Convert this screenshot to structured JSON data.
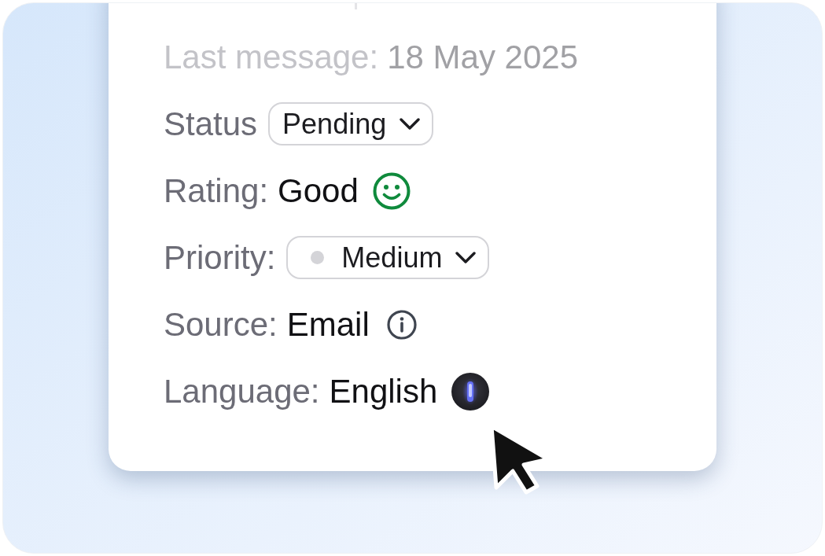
{
  "last_message": {
    "label": "Last message:",
    "value": "18 May 2025"
  },
  "fields": [
    {
      "kind": "dropdown",
      "label": "Status",
      "value": "Pending"
    },
    {
      "kind": "rating",
      "label": "Rating:",
      "value": "Good"
    },
    {
      "kind": "dropdown",
      "label": "Priority:",
      "value": "Medium",
      "color": "#d4d4d8"
    },
    {
      "kind": "info",
      "label": "Source:",
      "value": "Email"
    },
    {
      "kind": "assistant",
      "label": "Language:",
      "value": "English"
    }
  ]
}
